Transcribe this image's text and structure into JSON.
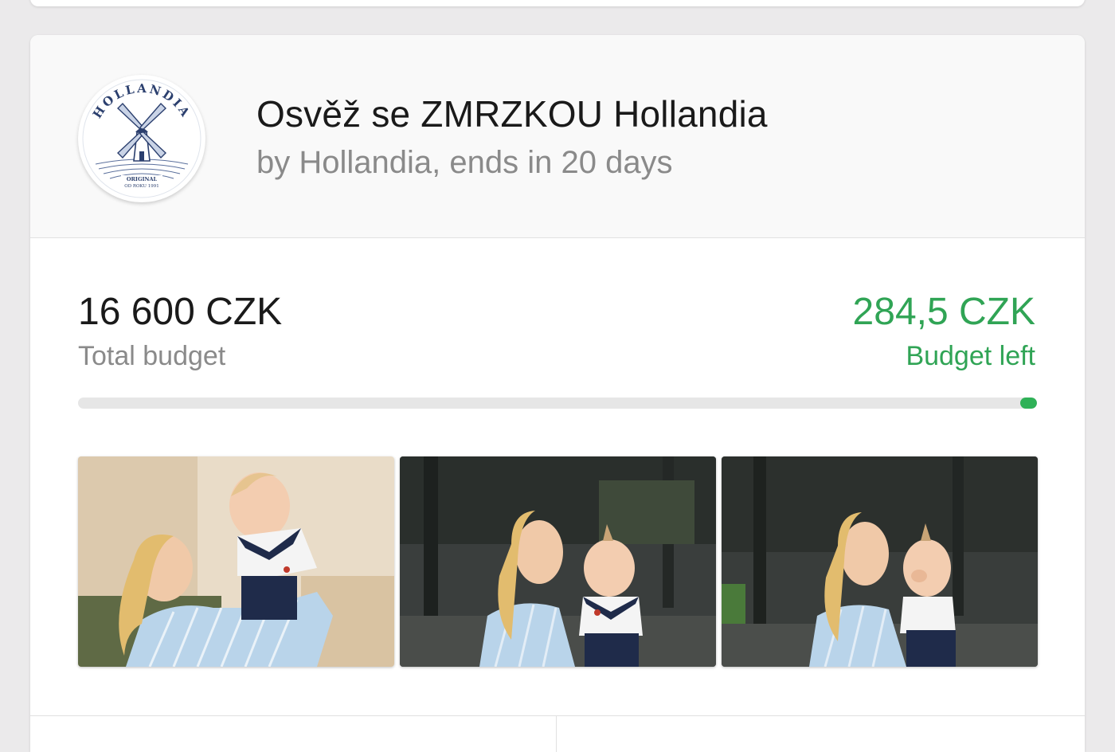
{
  "campaign": {
    "brand_logo_icon": "hollandia-windmill-logo",
    "title": "Osvěž se ZMRZKOU Hollandia",
    "subtitle": "by Hollandia, ends in 20 days"
  },
  "budget": {
    "total_value": "16 600 CZK",
    "total_label": "Total budget",
    "left_value": "284,5 CZK",
    "left_label": "Budget left",
    "left_fraction": 0.01714,
    "accent_color": "#30a455"
  },
  "photos": [
    {
      "icon": "photo-mother-lifting-baby"
    },
    {
      "icon": "photo-mother-holding-baby"
    },
    {
      "icon": "photo-mother-holding-baby-eating"
    }
  ]
}
